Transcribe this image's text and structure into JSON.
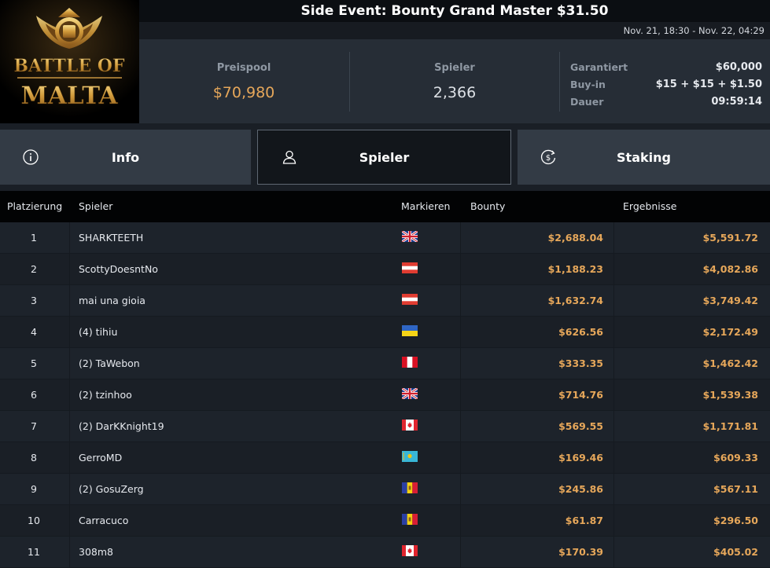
{
  "logo": {
    "line1": "BATTLE OF",
    "line2": "MALTA"
  },
  "event": {
    "title": "Side Event: Bounty Grand Master $31.50",
    "dates": "Nov. 21, 18:30 - Nov. 22, 04:29"
  },
  "stats": {
    "prizepool_label": "Preispool",
    "prizepool_value": "$70,980",
    "players_label": "Spieler",
    "players_value": "2,366",
    "guaranteed_label": "Garantiert",
    "guaranteed_value": "$60,000",
    "buyin_label": "Buy-in",
    "buyin_value": "$15 + $15 + $1.50",
    "duration_label": "Dauer",
    "duration_value": "09:59:14"
  },
  "tabs": [
    {
      "label": "Info",
      "icon": "info-icon"
    },
    {
      "label": "Spieler",
      "icon": "user-icon",
      "active": true
    },
    {
      "label": "Staking",
      "icon": "dollar-circle-icon"
    }
  ],
  "table": {
    "headers": {
      "rank": "Platzierung",
      "player": "Spieler",
      "flag": "Markieren",
      "bounty": "Bounty",
      "result": "Ergebnisse"
    },
    "rows": [
      {
        "rank": "1",
        "player": "SHARKTEETH",
        "flag": "gb",
        "bounty": "$2,688.04",
        "result": "$5,591.72"
      },
      {
        "rank": "2",
        "player": "ScottyDoesntNo",
        "flag": "at",
        "bounty": "$1,188.23",
        "result": "$4,082.86"
      },
      {
        "rank": "3",
        "player": "mai una gioia",
        "flag": "at",
        "bounty": "$1,632.74",
        "result": "$3,749.42"
      },
      {
        "rank": "4",
        "player": "(4) tihiu",
        "flag": "ua",
        "bounty": "$626.56",
        "result": "$2,172.49"
      },
      {
        "rank": "5",
        "player": "(2) TaWebon",
        "flag": "pe",
        "bounty": "$333.35",
        "result": "$1,462.42"
      },
      {
        "rank": "6",
        "player": "(2) tzinhoo",
        "flag": "gb",
        "bounty": "$714.76",
        "result": "$1,539.38"
      },
      {
        "rank": "7",
        "player": "(2) DarKKnight19",
        "flag": "ca",
        "bounty": "$569.55",
        "result": "$1,171.81"
      },
      {
        "rank": "8",
        "player": "GerroMD",
        "flag": "kz",
        "bounty": "$169.46",
        "result": "$609.33"
      },
      {
        "rank": "9",
        "player": "(2) GosuZerg",
        "flag": "md",
        "bounty": "$245.86",
        "result": "$567.11"
      },
      {
        "rank": "10",
        "player": "Carracuco",
        "flag": "md",
        "bounty": "$61.87",
        "result": "$296.50"
      },
      {
        "rank": "11",
        "player": "308m8",
        "flag": "ca",
        "bounty": "$170.39",
        "result": "$405.02"
      }
    ]
  },
  "colors": {
    "accent": "#e6a75a",
    "tab_bg": "#333b45",
    "active_tab_bg": "#12161b"
  }
}
